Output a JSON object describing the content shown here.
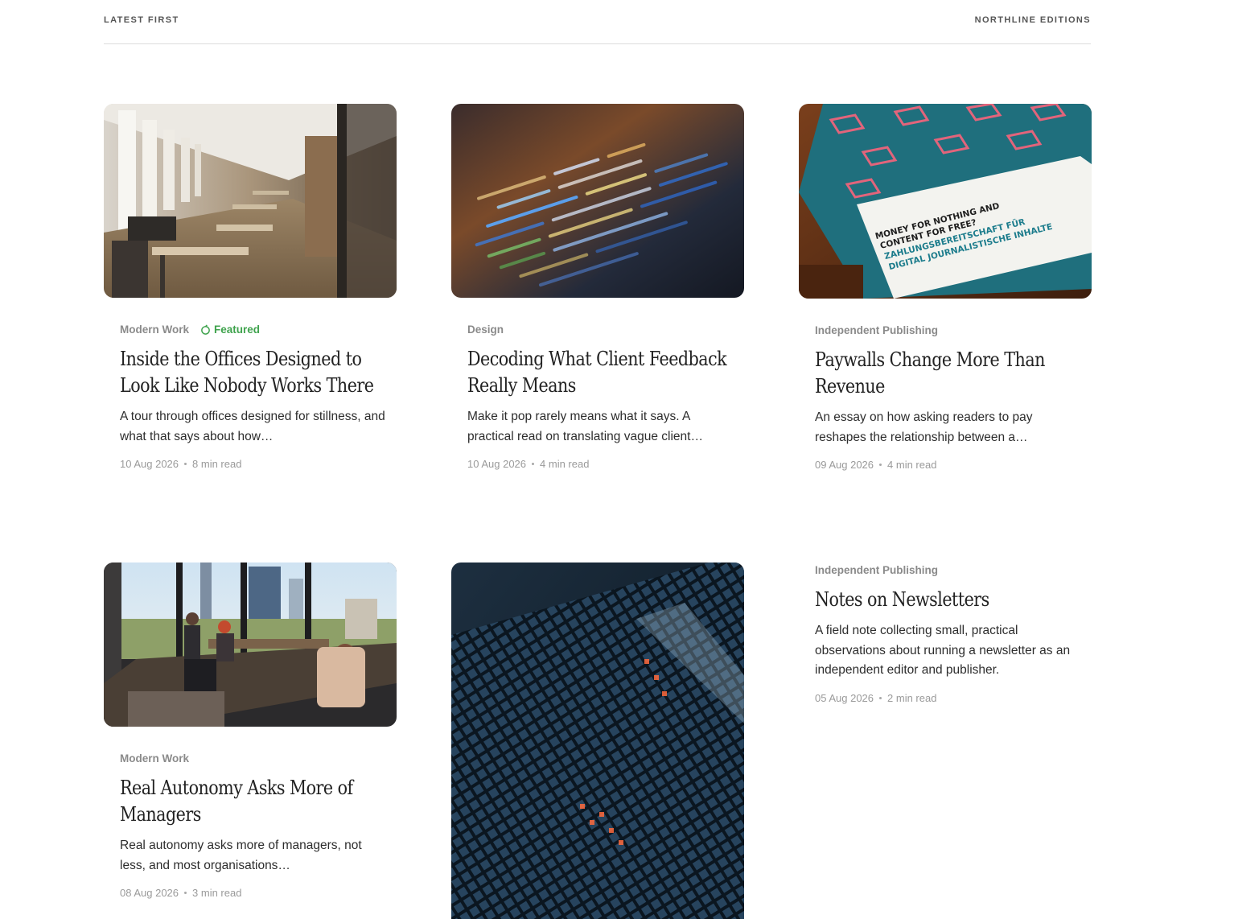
{
  "header": {
    "left_label": "LATEST FIRST",
    "right_label": "NORTHLINE EDITIONS"
  },
  "articles": [
    {
      "category": "Modern Work",
      "featured_label": "Featured",
      "title": "Inside the Offices Designed to Look Like Nobody Works There",
      "excerpt": "A tour through offices designed for stillness, and what that says about how…",
      "date": "10 Aug 2026",
      "read_time": "8 min read",
      "image": "office-interior-photo"
    },
    {
      "category": "Design",
      "title": "Decoding What Client Feedback Really Means",
      "excerpt": "Make it pop rarely means what it says. A practical read on translating vague client…",
      "date": "10 Aug 2026",
      "read_time": "4 min read",
      "image": "code-screen-photo"
    },
    {
      "category": "Independent Publishing",
      "title": "Paywalls Change More Than Revenue",
      "excerpt": "An essay on how asking readers to pay reshapes the relationship between a…",
      "date": "09 Aug 2026",
      "read_time": "4 min read",
      "image": "report-booklet-photo",
      "image_text": [
        "MONEY FOR NOTHING AND",
        "CONTENT FOR FREE?",
        "ZAHLUNGSBEREITSCHAFT FÜR",
        "DIGITAL JOURNALISTISCHE INHALTE"
      ]
    },
    {
      "category": "Modern Work",
      "title": "Real Autonomy Asks More of Managers",
      "excerpt": "Real autonomy asks more of managers, not less, and most organisations…",
      "date": "08 Aug 2026",
      "read_time": "3 min read",
      "image": "open-office-city-view-photo"
    },
    {
      "image": "dark-grid-facade-photo"
    },
    {
      "category": "Independent Publishing",
      "title": "Notes on Newsletters",
      "excerpt": "A field note collecting small, practical observations about running a newsletter as an independent editor and publisher.",
      "date": "05 Aug 2026",
      "read_time": "2 min read"
    }
  ],
  "colors": {
    "featured_accent": "#3fa34d",
    "category_text": "#8a8a8a",
    "rule": "#dcdcdc"
  }
}
